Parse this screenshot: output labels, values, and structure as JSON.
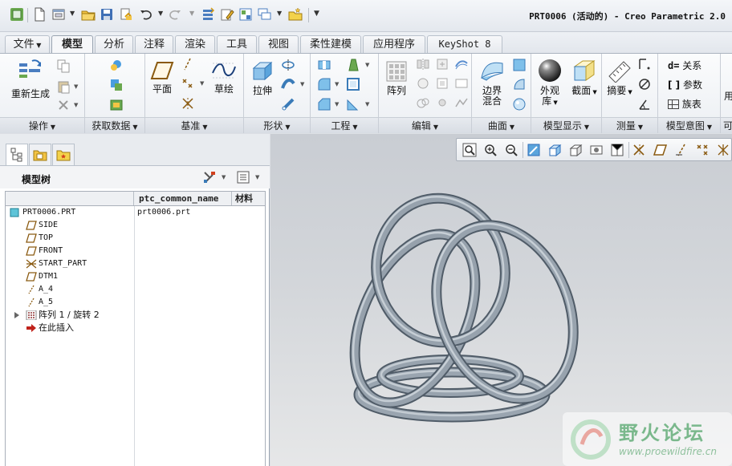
{
  "window": {
    "title": "PRT0006 (活动的) - Creo Parametric 2.0"
  },
  "tabs": [
    {
      "label": "文件",
      "has_dropdown": true
    },
    {
      "label": "模型",
      "active": true
    },
    {
      "label": "分析"
    },
    {
      "label": "注释"
    },
    {
      "label": "渲染"
    },
    {
      "label": "工具"
    },
    {
      "label": "视图"
    },
    {
      "label": "柔性建模"
    },
    {
      "label": "应用程序"
    },
    {
      "label": "KeyShot 8"
    }
  ],
  "ribbon": {
    "groups": [
      {
        "label": "操作",
        "buttons": [
          "重新生成"
        ]
      },
      {
        "label": "获取数据",
        "buttons": []
      },
      {
        "label": "基准",
        "buttons": [
          "平面",
          "草绘"
        ]
      },
      {
        "label": "形状",
        "buttons": [
          "拉伸"
        ]
      },
      {
        "label": "工程",
        "buttons": []
      },
      {
        "label": "编辑",
        "buttons": [
          "阵列"
        ]
      },
      {
        "label": "曲面",
        "buttons": [
          "边界混合"
        ]
      },
      {
        "label": "模型显示",
        "buttons": [
          "外观库",
          "截面"
        ]
      },
      {
        "label": "测量",
        "buttons": [
          "摘要"
        ]
      },
      {
        "label": "模型意图",
        "buttons": [
          "关系",
          "参数",
          "族表"
        ]
      },
      {
        "label": "可",
        "buttons": [
          "用"
        ]
      }
    ],
    "labels": {
      "regen": "重新生成",
      "plane": "平面",
      "sketch": "草绘",
      "extrude": "拉伸",
      "pattern": "阵列",
      "boundary_line1": "边界",
      "boundary_line2": "混合",
      "appearance_line1": "外观",
      "appearance_line2": "库",
      "section": "截面",
      "summary": "摘要",
      "relations": "关系",
      "parameters": "参数",
      "family_table": "族表",
      "cut_off": "用"
    }
  },
  "model_tree": {
    "title": "模型树",
    "columns": [
      "ptc_common_name",
      "材料"
    ],
    "rows": [
      {
        "name": "PRT0006.PRT",
        "icon": "part-icon",
        "common_name": "prt0006.prt"
      },
      {
        "name": "SIDE",
        "icon": "datum-plane-icon"
      },
      {
        "name": "TOP",
        "icon": "datum-plane-icon"
      },
      {
        "name": "FRONT",
        "icon": "datum-plane-icon"
      },
      {
        "name": "START_PART",
        "icon": "coordinate-system-icon"
      },
      {
        "name": "DTM1",
        "icon": "datum-plane-icon"
      },
      {
        "name": "A_4",
        "icon": "axis-icon"
      },
      {
        "name": "A_5",
        "icon": "axis-icon"
      },
      {
        "name": "阵列 1 / 旋转 2",
        "icon": "pattern-icon",
        "expandable": true
      },
      {
        "name": "在此插入",
        "icon": "insert-arrow-icon"
      }
    ]
  },
  "watermark": {
    "title": "野火论坛",
    "url": "www.proewildfire.cn"
  },
  "colors": {
    "model": "#8f9aa5",
    "accent": "#3a7bd5",
    "watermark": "#7ab88c"
  }
}
